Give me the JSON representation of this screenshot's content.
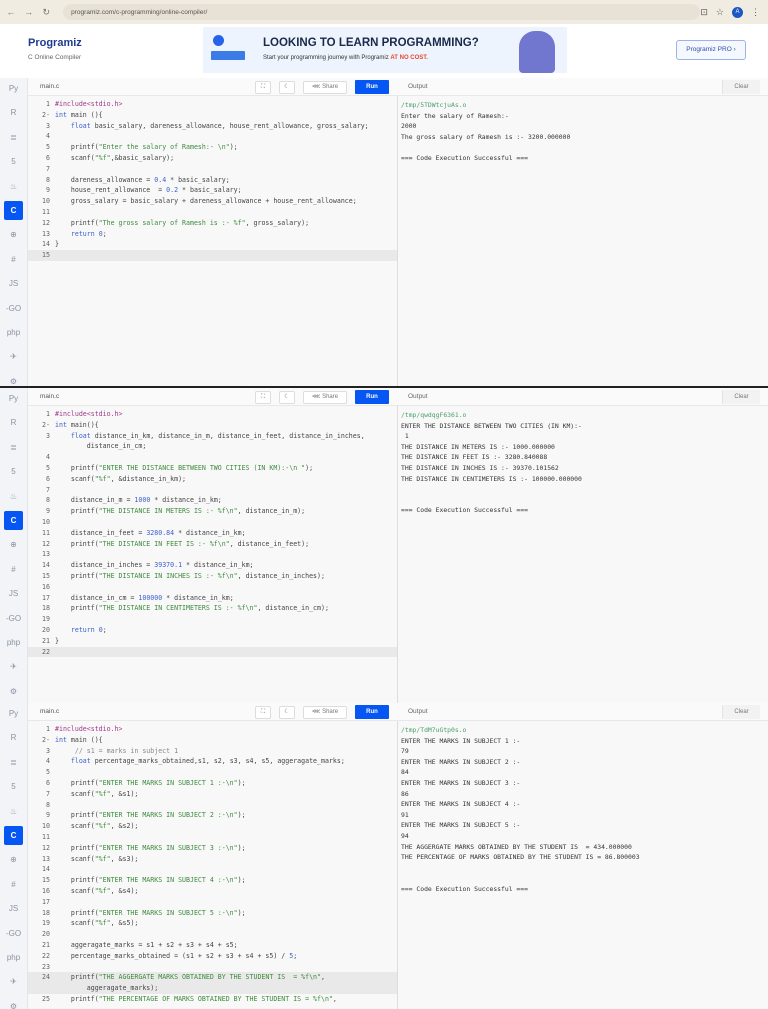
{
  "browser": {
    "url": "programiz.com/c-programming/online-compiler/",
    "avatar": "A"
  },
  "header": {
    "logo": "Programiz",
    "subtitle": "C Online Compiler",
    "banner_title": "LOOKING TO LEARN PROGRAMMING?",
    "banner_text": "Start your programming journey with Programiz ",
    "banner_highlight": "AT NO COST.",
    "pro_button": "Programiz PRO ›"
  },
  "sidebar": [
    "Py",
    "R",
    "≣",
    "5",
    "♨",
    "C",
    "⊕",
    "#",
    "JS",
    "-GO",
    "php",
    "✈",
    "⚙"
  ],
  "toolbar": {
    "tab": "main.c",
    "share": "Share",
    "run": "Run",
    "output": "Output",
    "clear": "Clear"
  },
  "panels": [
    {
      "active_line": 15,
      "code": [
        "#include<stdio.h>",
        "int main (){",
        "    float basic_salary, dareness_allowance, house_rent_allowance, gross_salary;",
        "",
        "    printf(\"Enter the salary of Ramesh:- \\n\");",
        "    scanf(\"%f\",&basic_salary);",
        "",
        "    dareness_allowance = 0.4 * basic_salary;",
        "    house_rent_allowance  = 0.2 * basic_salary;",
        "    gross_salary = basic_salary + dareness_allowance + house_rent_allowance;",
        "",
        "    printf(\"The gross salary of Ramesh is :- %f\", gross_salary);",
        "    return 0;",
        "}",
        ""
      ],
      "output": [
        "/tmp/5TDWtcjuAs.o",
        "Enter the salary of Ramesh:-",
        "2000",
        "The gross salary of Ramesh is :- 3200.000000",
        "",
        "=== Code Execution Successful ==="
      ]
    },
    {
      "active_line": 22,
      "code": [
        "#include<stdio.h>",
        "int main(){",
        "    float distance_in_km, distance_in_m, distance_in_feet, distance_in_inches,\n        distance_in_cm;",
        "",
        "    printf(\"ENTER THE DISTANCE BETWEEN TWO CITIES (IN KM):-\\n \");",
        "    scanf(\"%f\", &distance_in_km);",
        "",
        "    distance_in_m = 1000 * distance_in_km;",
        "    printf(\"THE DISTANCE IN METERS IS :- %f\\n\", distance_in_m);",
        "",
        "    distance_in_feet = 3280.84 * distance_in_km;",
        "    printf(\"THE DISTANCE IN FEET IS :- %f\\n\", distance_in_feet);",
        "",
        "    distance_in_inches = 39370.1 * distance_in_km;",
        "    printf(\"THE DISTANCE IN INCHES IS :- %f\\n\", distance_in_inches);",
        "",
        "    distance_in_cm = 100000 * distance_in_km;",
        "    printf(\"THE DISTANCE IN CENTIMETERS IS :- %f\\n\", distance_in_cm);",
        "",
        "    return 0;",
        "}",
        ""
      ],
      "output": [
        "/tmp/qwdqgF6361.o",
        "ENTER THE DISTANCE BETWEEN TWO CITIES (IN KM):-",
        " 1",
        "THE DISTANCE IN METERS IS :- 1000.000000",
        "THE DISTANCE IN FEET IS :- 3280.840088",
        "THE DISTANCE IN INCHES IS :- 39370.101562",
        "THE DISTANCE IN CENTIMETERS IS :- 100000.000000",
        "",
        "",
        "=== Code Execution Successful ==="
      ]
    },
    {
      "active_line": 24,
      "code": [
        "#include<stdio.h>",
        "int main (){",
        "     // s1 = marks in subject 1",
        "    float percentage_marks_obtained,s1, s2, s3, s4, s5, aggeragate_marks;",
        "",
        "    printf(\"ENTER THE MARKS IN SUBJECT 1 :-\\n\");",
        "    scanf(\"%f\", &s1);",
        "",
        "    printf(\"ENTER THE MARKS IN SUBJECT 2 :-\\n\");",
        "    scanf(\"%f\", &s2);",
        "",
        "    printf(\"ENTER THE MARKS IN SUBJECT 3 :-\\n\");",
        "    scanf(\"%f\", &s3);",
        "",
        "    printf(\"ENTER THE MARKS IN SUBJECT 4 :-\\n\");",
        "    scanf(\"%f\", &s4);",
        "",
        "    printf(\"ENTER THE MARKS IN SUBJECT 5 :-\\n\");",
        "    scanf(\"%f\", &s5);",
        "",
        "    aggeragate_marks = s1 + s2 + s3 + s4 + s5;",
        "    percentage_marks_obtained = (s1 + s2 + s3 + s4 + s5) / 5;",
        "",
        "    printf(\"THE AGGERGATE MARKS OBTAINED BY THE STUDENT IS  = %f\\n\",\n        aggeragate_marks);",
        "    printf(\"THE PERCENTAGE OF MARKS OBTAINED BY THE STUDENT IS = %f\\n\","
      ],
      "output": [
        "/tmp/TdM7uGtp0s.o",
        "ENTER THE MARKS IN SUBJECT 1 :-",
        "79",
        "ENTER THE MARKS IN SUBJECT 2 :-",
        "84",
        "ENTER THE MARKS IN SUBJECT 3 :-",
        "86",
        "ENTER THE MARKS IN SUBJECT 4 :-",
        "91",
        "ENTER THE MARKS IN SUBJECT 5 :-",
        "94",
        "THE AGGERGATE MARKS OBTAINED BY THE STUDENT IS  = 434.000000",
        "THE PERCENTAGE OF MARKS OBTAINED BY THE STUDENT IS = 86.800003",
        "",
        "",
        "=== Code Execution Successful ==="
      ]
    }
  ]
}
